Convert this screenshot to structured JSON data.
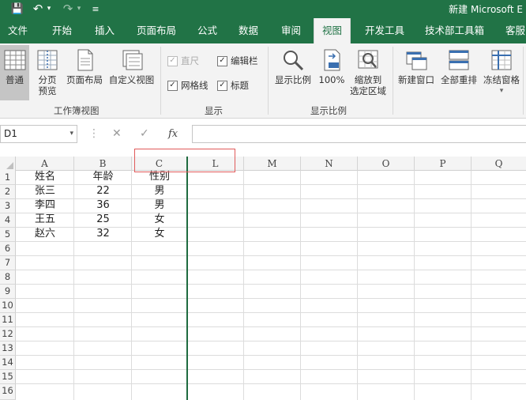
{
  "title_bar": {
    "title": "新建 Microsoft E",
    "save_glyph": "💾",
    "undo_glyph": "↶",
    "undo_drop": "▾",
    "redo_glyph": "↷",
    "redo_drop": "▾",
    "customize_glyph": "≡"
  },
  "tabs": [
    {
      "label": "文件",
      "active": false
    },
    {
      "label": "开始",
      "active": false
    },
    {
      "label": "插入",
      "active": false
    },
    {
      "label": "页面布局",
      "active": false
    },
    {
      "label": "公式",
      "active": false
    },
    {
      "label": "数据",
      "active": false
    },
    {
      "label": "审阅",
      "active": false
    },
    {
      "label": "视图",
      "active": true
    },
    {
      "label": "开发工具",
      "active": false
    },
    {
      "label": "技术部工具箱",
      "active": false
    },
    {
      "label": "客服",
      "active": false
    }
  ],
  "ribbon": {
    "workbook_views": {
      "label": "工作簿视图",
      "normal": "普通",
      "page_break": "分页\n预览",
      "page_break_line1": "分页",
      "page_break_line2": "预览",
      "page_layout": "页面布局",
      "custom_views": "自定义视图"
    },
    "show": {
      "label": "显示",
      "ruler": {
        "label": "直尺",
        "checked": true,
        "disabled": true
      },
      "formula_bar": {
        "label": "编辑栏",
        "checked": true
      },
      "gridlines": {
        "label": "网格线",
        "checked": true
      },
      "headings": {
        "label": "标题",
        "checked": true
      },
      "check_glyph": "✓"
    },
    "zoom": {
      "label": "显示比例",
      "zoom": "显示比例",
      "hundred": "100%",
      "zoom_selection_line1": "缩放到",
      "zoom_selection_line2": "选定区域"
    },
    "window": {
      "new_window": "新建窗口",
      "arrange_all": "全部重排",
      "freeze_panes": "冻结窗格",
      "freeze_drop": "▾"
    }
  },
  "formula_bar": {
    "name_box": "D1",
    "name_box_arrow": "▾",
    "more_glyph": "⋮",
    "cancel_glyph": "✕",
    "enter_glyph": "✓",
    "fx": "fx",
    "value": ""
  },
  "columns": [
    "A",
    "B",
    "C",
    "L",
    "M",
    "N",
    "O",
    "P",
    "Q"
  ],
  "rows": [
    "1",
    "2",
    "3",
    "4",
    "5",
    "6",
    "7",
    "8",
    "9",
    "10",
    "11",
    "12",
    "13",
    "14",
    "15",
    "16"
  ],
  "cells": [
    [
      "姓名",
      "年龄",
      "性别"
    ],
    [
      "张三",
      "22",
      "男"
    ],
    [
      "李四",
      "36",
      "男"
    ],
    [
      "王五",
      "25",
      "女"
    ],
    [
      "赵六",
      "32",
      "女"
    ]
  ],
  "colors": {
    "excel_green": "#217346",
    "highlight_red": "#e05a5a"
  }
}
